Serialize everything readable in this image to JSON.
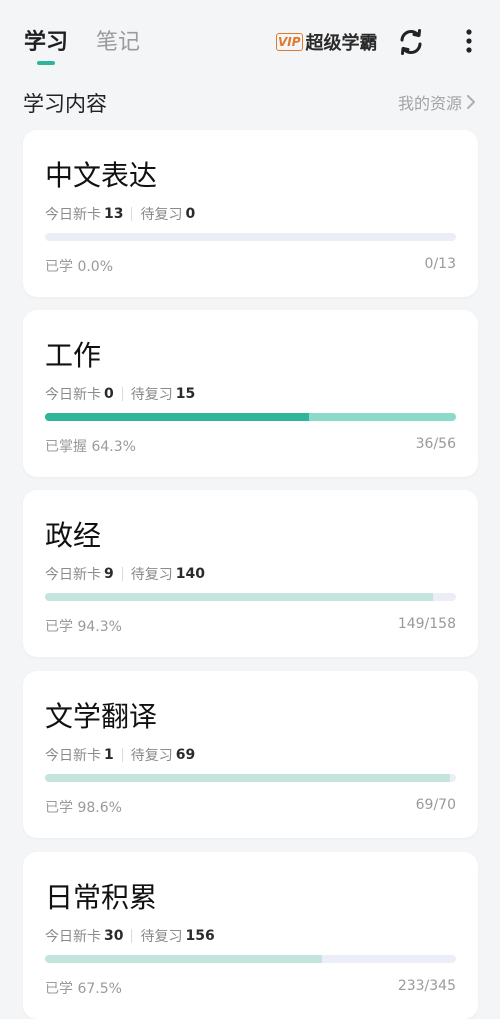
{
  "tabs": {
    "study": "学习",
    "notes": "笔记"
  },
  "vip": {
    "badge": "VIP",
    "label": "超级学霸"
  },
  "icons": {
    "refresh": "refresh-icon",
    "more": "more-vertical-icon"
  },
  "section": {
    "title": "学习内容",
    "link": "我的资源"
  },
  "labels": {
    "new_today": "今日新卡",
    "to_review": "待复习"
  },
  "colors": {
    "accent": "#2fb59a",
    "vip": "#e07a2e",
    "track": "#eceef7",
    "learned_fill": "#c4e5dd"
  },
  "decks": [
    {
      "title": "中文表达",
      "new_today": "13",
      "to_review": "0",
      "progress_text": "已学 0.0%",
      "count": "0/13",
      "learned_fraction": 0.0,
      "mastered_fraction": 0.0
    },
    {
      "title": "工作",
      "new_today": "0",
      "to_review": "15",
      "progress_text": "已掌握 64.3%",
      "count": "36/56",
      "learned_fraction": 1.0,
      "mastered_fraction": 0.643
    },
    {
      "title": "政经",
      "new_today": "9",
      "to_review": "140",
      "progress_text": "已学 94.3%",
      "count": "149/158",
      "learned_fraction": 0.943,
      "mastered_fraction": 0.0
    },
    {
      "title": "文学翻译",
      "new_today": "1",
      "to_review": "69",
      "progress_text": "已学 98.6%",
      "count": "69/70",
      "learned_fraction": 0.986,
      "mastered_fraction": 0.0
    },
    {
      "title": "日常积累",
      "new_today": "30",
      "to_review": "156",
      "progress_text": "已学 67.5%",
      "count": "233/345",
      "learned_fraction": 0.675,
      "mastered_fraction": 0.0
    }
  ]
}
